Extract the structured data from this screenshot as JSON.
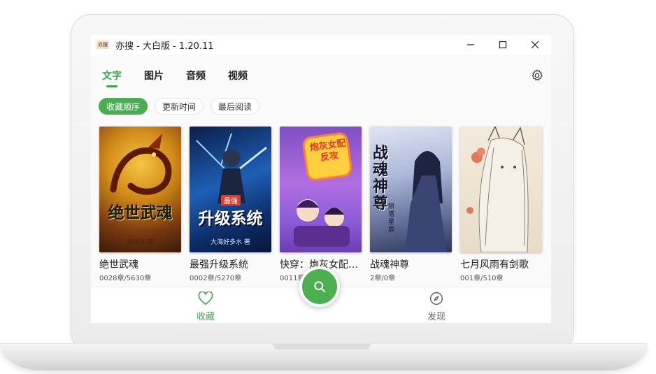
{
  "window": {
    "logo_text": "亦搜",
    "title": "亦搜 - 大白版 - 1.20.11"
  },
  "tabs": [
    {
      "label": "文字",
      "active": true
    },
    {
      "label": "图片"
    },
    {
      "label": "音频"
    },
    {
      "label": "视频"
    }
  ],
  "sort_chips": [
    {
      "label": "收藏顺序",
      "active": true
    },
    {
      "label": "更新时间"
    },
    {
      "label": "最后阅读"
    }
  ],
  "books": [
    {
      "title": "绝世武魂",
      "progress": "0028章/5630章",
      "cover_text": "绝世武魂",
      "author": "洛城东/著"
    },
    {
      "title": "最强升级系统",
      "progress": "0002章/5270章",
      "cover_text": "升级系统",
      "badge": "最强",
      "author": "大海好多水 著"
    },
    {
      "title": "快穿：炮灰女配…",
      "progress": "0011章",
      "cover_text": "炮灰女配反攻"
    },
    {
      "title": "战魂神尊",
      "progress": "2章/0章",
      "cover_text": "战魂神尊",
      "author": "陨落星辰"
    },
    {
      "title": "七月风雨有剑歌",
      "progress": "001章/510章"
    }
  ],
  "bottom_nav": {
    "favorites_label": "收藏",
    "discover_label": "发现"
  },
  "colors": {
    "accent": "#3aaa48",
    "chip_active": "#49ad52",
    "fab": "#4caf50"
  },
  "icons": [
    "app-logo",
    "minimize-icon",
    "maximize-icon",
    "close-icon",
    "settings-gear-icon",
    "heart-icon",
    "search-icon",
    "compass-icon"
  ]
}
